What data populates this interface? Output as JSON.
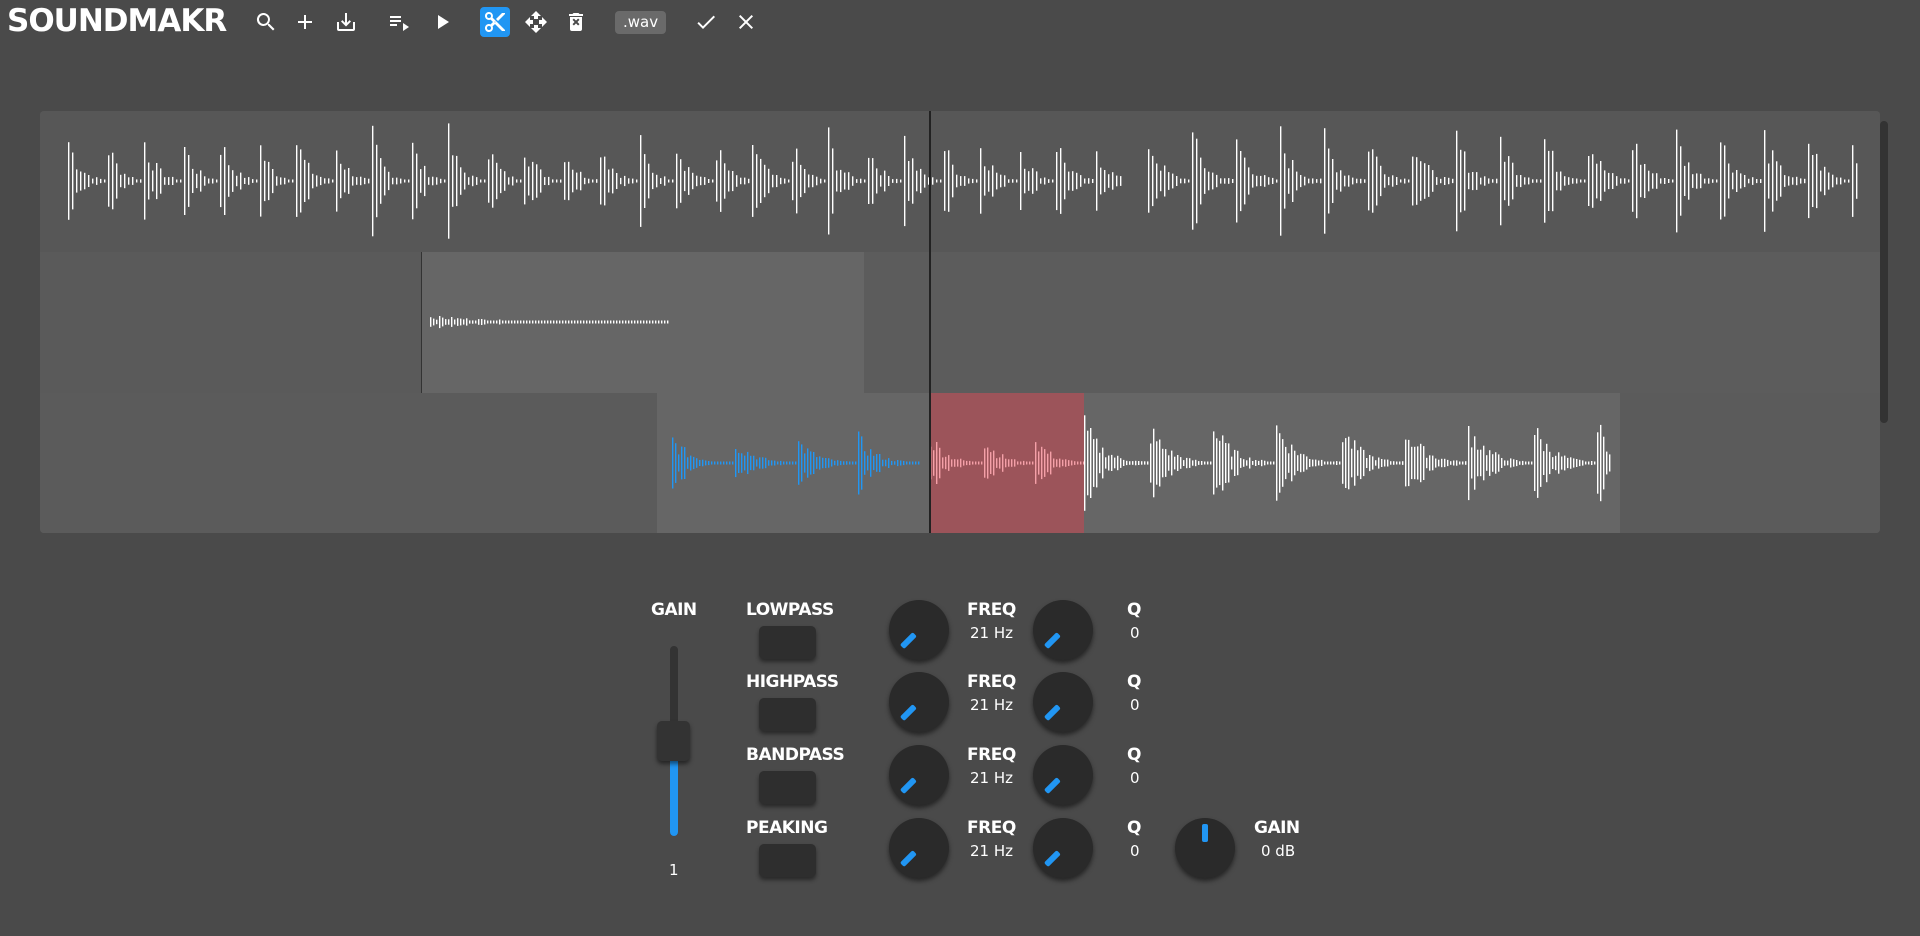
{
  "app": {
    "title": "SOUNDMAKR"
  },
  "toolbar": {
    "buttons": [
      {
        "name": "search-icon"
      },
      {
        "name": "add-icon"
      },
      {
        "name": "download-icon"
      },
      {
        "name": "playlist-icon"
      },
      {
        "name": "play-icon"
      },
      {
        "name": "scissors-icon"
      },
      {
        "name": "move-icon"
      },
      {
        "name": "delete-icon"
      }
    ],
    "format": ".wav",
    "confirm_icon": "check-icon",
    "cancel_icon": "close-icon",
    "active_tool": "scissors-icon"
  },
  "colors": {
    "background": "#4a4a4a",
    "accent": "#2196f3",
    "selection": "#c84650",
    "waveform": "#ffffff"
  },
  "controls": {
    "gain": {
      "label": "GAIN",
      "value": "1"
    },
    "filters": [
      {
        "name": "LOWPASS",
        "freq_label": "FREQ",
        "freq_value": "21 Hz",
        "q_label": "Q",
        "q_value": "0"
      },
      {
        "name": "HIGHPASS",
        "freq_label": "FREQ",
        "freq_value": "21 Hz",
        "q_label": "Q",
        "q_value": "0"
      },
      {
        "name": "BANDPASS",
        "freq_label": "FREQ",
        "freq_value": "21 Hz",
        "q_label": "Q",
        "q_value": "0"
      },
      {
        "name": "PEAKING",
        "freq_label": "FREQ",
        "freq_value": "21 Hz",
        "q_label": "Q",
        "q_value": "0",
        "gain_label": "GAIN",
        "gain_value": "0 dB"
      }
    ]
  }
}
